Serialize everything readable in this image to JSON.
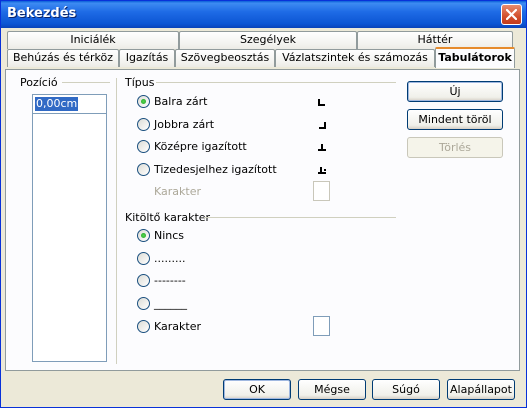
{
  "window": {
    "title": "Bekezdés"
  },
  "tabs": {
    "row1": [
      "Iniciálék",
      "Szegélyek",
      "Háttér"
    ],
    "row2": [
      "Behúzás és térköz",
      "Igazítás",
      "Szövegbeosztás",
      "Vázlatszintek és számozás",
      "Tabulátorok"
    ],
    "active": "Tabulátorok"
  },
  "position": {
    "label": "Pozíció",
    "value": "0,00cm"
  },
  "type": {
    "label": "Típus",
    "options": [
      {
        "label": "Balra zárt",
        "checked": true
      },
      {
        "label": "Jobbra zárt",
        "checked": false
      },
      {
        "label": "Középre igazított",
        "checked": false
      },
      {
        "label": "Tizedesjelhez igazított",
        "checked": false
      }
    ],
    "character_label": "Karakter"
  },
  "fill": {
    "label": "Kitöltő karakter",
    "options": [
      {
        "label": "Nincs",
        "checked": true
      },
      {
        "label": ".........",
        "checked": false
      },
      {
        "label": "--------",
        "checked": false
      },
      {
        "label": "______",
        "checked": false
      },
      {
        "label": "Karakter",
        "checked": false
      }
    ]
  },
  "side_buttons": {
    "new": "Új",
    "delete_all": "Mindent töröl",
    "delete": "Törlés"
  },
  "bottom_buttons": {
    "ok": "OK",
    "cancel": "Mégse",
    "help": "Súgó",
    "reset": "Alapállapot"
  }
}
